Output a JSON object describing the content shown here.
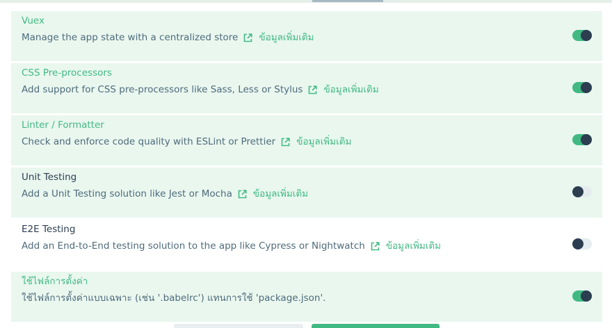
{
  "colors": {
    "accent": "#42b983",
    "dark": "#2c3e50",
    "selected_bg": "#e9f7ef",
    "description": "#4f6b7a"
  },
  "link_icon": "external-link-icon",
  "features": [
    {
      "name": "Vuex",
      "description": "Manage the app state with a centralized store",
      "link_label": "ข้อมูลเพิ่มเติม",
      "enabled": true
    },
    {
      "name": "CSS Pre-processors",
      "description": "Add support for CSS pre-processors like Sass, Less or Stylus",
      "link_label": "ข้อมูลเพิ่มเติม",
      "enabled": true
    },
    {
      "name": "Linter / Formatter",
      "description": "Check and enforce code quality with ESLint or Prettier",
      "link_label": "ข้อมูลเพิ่มเติม",
      "enabled": true
    },
    {
      "name": "Unit Testing",
      "description": "Add a Unit Testing solution like Jest or Mocha",
      "link_label": "ข้อมูลเพิ่มเติม",
      "enabled": false
    },
    {
      "name": "E2E Testing",
      "description": "Add an End-to-End testing solution to the app like Cypress or Nightwatch",
      "link_label": "ข้อมูลเพิ่มเติม",
      "enabled": false
    },
    {
      "name": "ใช้ไฟล์การตั้งค่า",
      "description": "ใช้ไฟล์การตั้งค่าแบบเฉพาะ (เช่น '.babelrc') แทนการใช้ 'package.json'.",
      "link_label": "",
      "enabled": true
    }
  ]
}
